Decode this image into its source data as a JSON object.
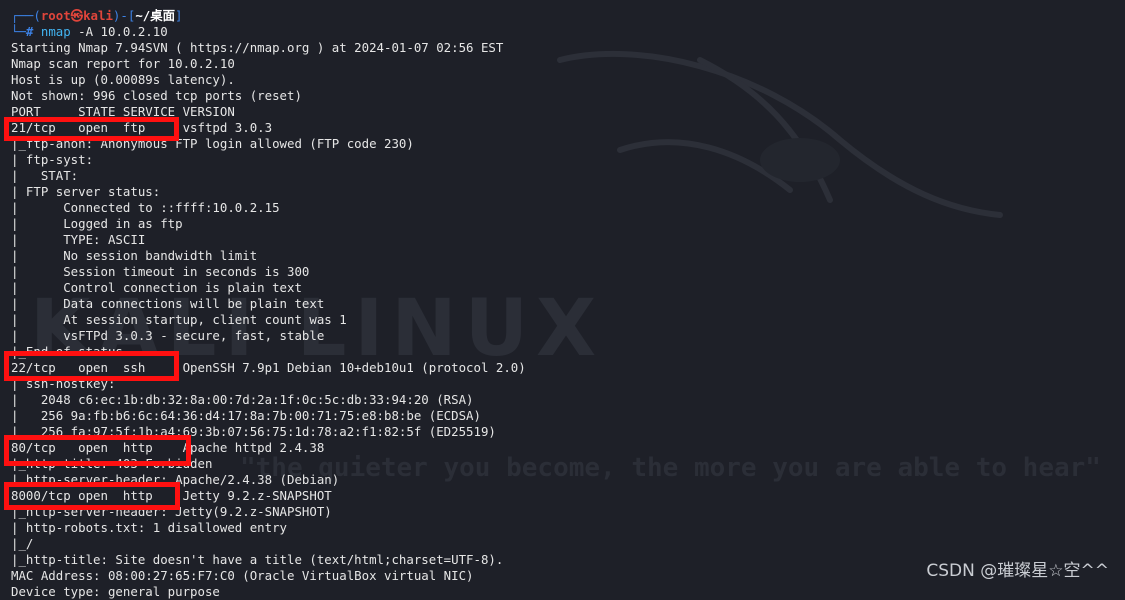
{
  "colors": {
    "background": "#1e2028",
    "text": "#e6e6e6",
    "prompt_frame": "#3c82e6",
    "prompt_user": "#e0453b",
    "command": "#42b3f0",
    "highlight_box": "#ff1010"
  },
  "prompt": {
    "frame_open": "┌──(",
    "user": "root㉿kali",
    "frame_mid": ")-[",
    "dir": "~/桌面",
    "frame_close": "]",
    "frame_bottom": "└─",
    "hash": "#",
    "command_name": "nmap",
    "command_args": " -A 10.0.2.10"
  },
  "output_lines": [
    "Starting Nmap 7.94SVN ( https://nmap.org ) at 2024-01-07 02:56 EST",
    "Nmap scan report for 10.0.2.10",
    "Host is up (0.00089s latency).",
    "Not shown: 996 closed tcp ports (reset)",
    "PORT     STATE SERVICE VERSION",
    "21/tcp   open  ftp     vsftpd 3.0.3",
    "|_ftp-anon: Anonymous FTP login allowed (FTP code 230)",
    "| ftp-syst:",
    "|   STAT:",
    "| FTP server status:",
    "|      Connected to ::ffff:10.0.2.15",
    "|      Logged in as ftp",
    "|      TYPE: ASCII",
    "|      No session bandwidth limit",
    "|      Session timeout in seconds is 300",
    "|      Control connection is plain text",
    "|      Data connections will be plain text",
    "|      At session startup, client count was 1",
    "|      vsFTPd 3.0.3 - secure, fast, stable",
    "|_End of status",
    "22/tcp   open  ssh     OpenSSH 7.9p1 Debian 10+deb10u1 (protocol 2.0)",
    "| ssh-hostkey:",
    "|   2048 c6:ec:1b:db:32:8a:00:7d:2a:1f:0c:5c:db:33:94:20 (RSA)",
    "|   256 9a:fb:b6:6c:64:36:d4:17:8a:7b:00:71:75:e8:b8:be (ECDSA)",
    "|_  256 fa:97:5f:1b:a4:69:3b:07:56:75:1d:78:a2:f1:82:5f (ED25519)",
    "80/tcp   open  http    Apache httpd 2.4.38",
    "|_http-title: 403 Forbidden",
    "|_http-server-header: Apache/2.4.38 (Debian)",
    "8000/tcp open  http    Jetty 9.2.z-SNAPSHOT",
    "|_http-server-header: Jetty(9.2.z-SNAPSHOT)",
    "| http-robots.txt: 1 disallowed entry",
    "|_/",
    "|_http-title: Site doesn't have a title (text/html;charset=UTF-8).",
    "MAC Address: 08:00:27:65:F7:C0 (Oracle VirtualBox virtual NIC)",
    "Device type: general purpose"
  ],
  "background_logo": {
    "wordmark": "KALI LINUX",
    "tagline": "\"the quieter you become, the more you are able to hear\""
  },
  "csdn_watermark": "CSDN @璀璨星☆空^^"
}
